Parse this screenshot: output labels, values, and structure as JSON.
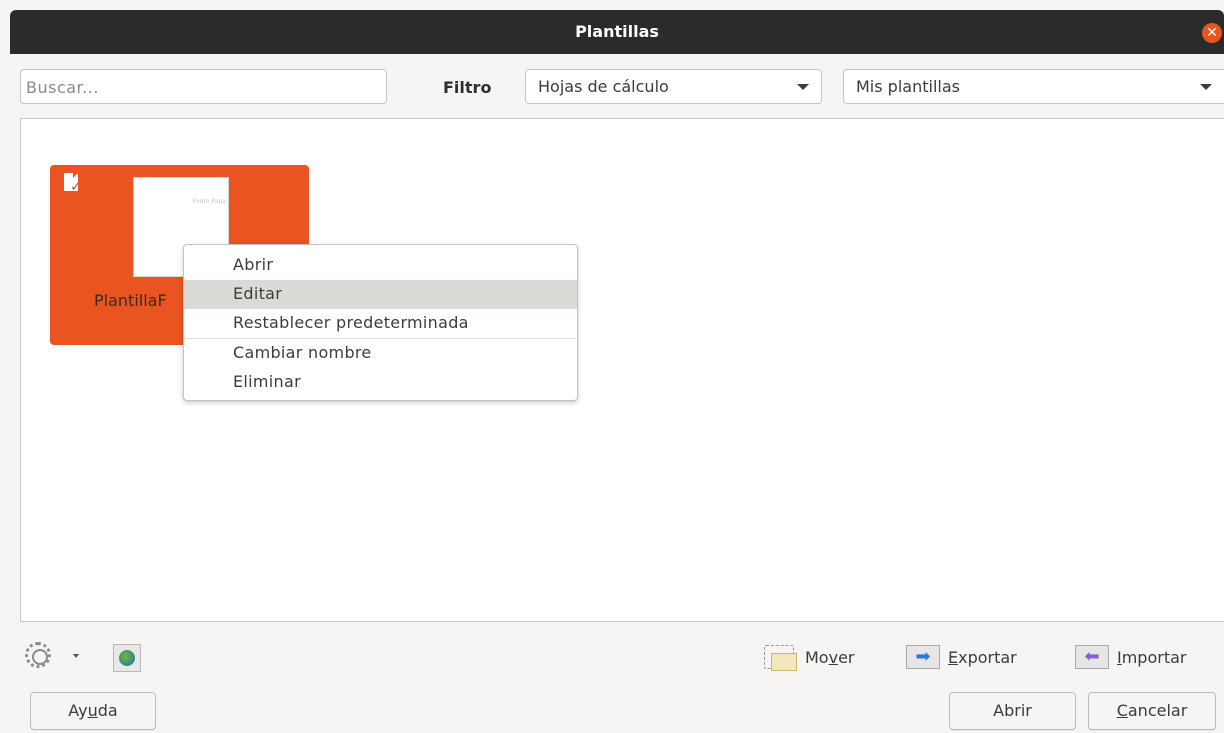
{
  "window": {
    "title": "Plantillas"
  },
  "search": {
    "placeholder": "Buscar..."
  },
  "filter": {
    "label": "Filtro",
    "type_selected": "Hojas de cálculo",
    "category_selected": "Mis plantillas"
  },
  "template": {
    "name": "PlantillaF",
    "thumbnail_text": "Pedro Papa"
  },
  "context_menu": {
    "items": [
      "Abrir",
      "Editar",
      "Restablecer predeterminada",
      "Cambiar nombre",
      "Eliminar"
    ],
    "highlighted": "Editar"
  },
  "toolbar": {
    "move": {
      "pre": "Mo",
      "key": "v",
      "post": "er"
    },
    "export": {
      "key": "E",
      "post": "xportar"
    },
    "import": {
      "key": "I",
      "post": "mportar"
    }
  },
  "buttons": {
    "help": {
      "pre": "Ay",
      "key": "u",
      "post": "da"
    },
    "open": "Abrir",
    "cancel": {
      "key": "C",
      "post": "ancelar"
    }
  },
  "icons": [
    "close-icon",
    "dropdown-arrow-icon",
    "template-doc-icon",
    "settings-gear-icon",
    "refresh-icon",
    "move-folder-icon",
    "export-icon",
    "import-icon"
  ],
  "colors": {
    "accent": "#e95420",
    "titlebar": "#2b2b2b"
  }
}
